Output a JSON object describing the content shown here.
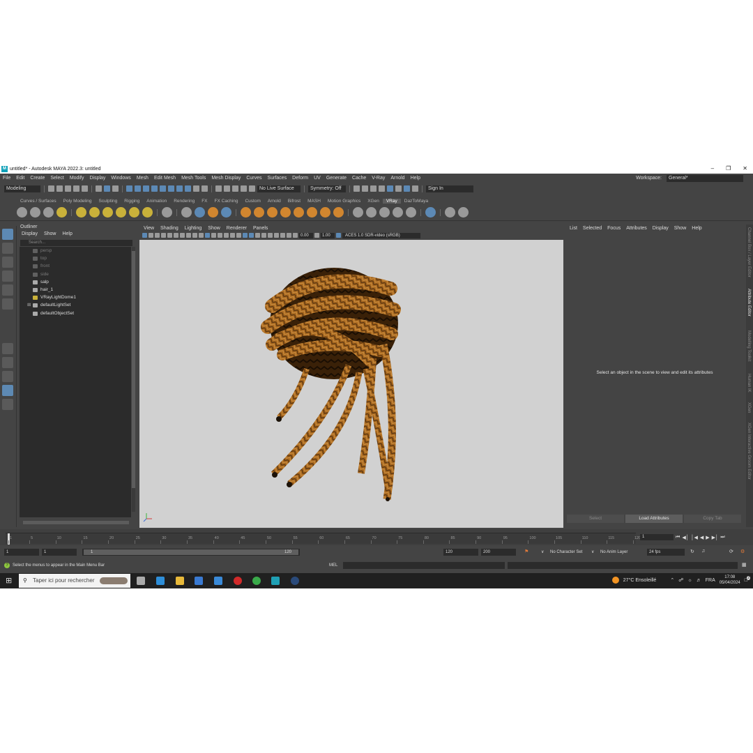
{
  "window": {
    "title": "untitled* - Autodesk MAYA 2022.3: untitled",
    "logo_text": "M"
  },
  "menubar": {
    "items": [
      "File",
      "Edit",
      "Create",
      "Select",
      "Modify",
      "Display",
      "Windows",
      "Mesh",
      "Edit Mesh",
      "Mesh Tools",
      "Mesh Display",
      "Curves",
      "Surfaces",
      "Deform",
      "UV",
      "Generate",
      "Cache",
      "V-Ray",
      "Arnold",
      "Help"
    ],
    "workspace_label": "Workspace:",
    "workspace_value": "General*"
  },
  "statusline": {
    "mode": "Modeling",
    "live_surface": "No Live Surface",
    "symmetry": "Symmetry: Off",
    "sign_in": "Sign In"
  },
  "shelf_tabs": [
    "Curves / Surfaces",
    "Poly Modeling",
    "Sculpting",
    "Rigging",
    "Animation",
    "Rendering",
    "FX",
    "FX Caching",
    "Custom",
    "Arnold",
    "Bifrost",
    "MASH",
    "Motion Graphics",
    "XGen",
    "VRay",
    "DazToMaya"
  ],
  "shelf_active": "VRay",
  "outliner": {
    "title": "Outliner",
    "menu": [
      "Display",
      "Show",
      "Help"
    ],
    "search_placeholder": "Search...",
    "items": [
      {
        "label": "persp",
        "dim": true
      },
      {
        "label": "top",
        "dim": true
      },
      {
        "label": "front",
        "dim": true
      },
      {
        "label": "side",
        "dim": true
      },
      {
        "label": "salp",
        "dim": false
      },
      {
        "label": "hair_1",
        "dim": false
      },
      {
        "label": "VRayLightDome1",
        "dim": false
      },
      {
        "label": "defaultLightSet",
        "dim": false
      },
      {
        "label": "defaultObjectSet",
        "dim": false
      }
    ]
  },
  "viewport": {
    "menu": [
      "View",
      "Shading",
      "Lighting",
      "Show",
      "Renderer",
      "Panels"
    ],
    "exposure": "0.00",
    "gamma": "1.00",
    "color_space": "ACES 1.0 SDR-video (sRGB)"
  },
  "attribute_editor": {
    "menu": [
      "List",
      "Selected",
      "Focus",
      "Attributes",
      "Display",
      "Show",
      "Help"
    ],
    "message": "Select an object in the scene to view and edit its attributes",
    "buttons": [
      "Select",
      "Load Attributes",
      "Copy Tab"
    ]
  },
  "side_tabs": [
    "Channel Box / Layer Editor",
    "Attribute Editor",
    "Modelling Toolkit",
    "Human IK",
    "XGen",
    "XGen Interactive Groom Editor"
  ],
  "timeline": {
    "ticks": [
      "1",
      "5",
      "10",
      "15",
      "20",
      "25",
      "30",
      "35",
      "40",
      "45",
      "50",
      "55",
      "60",
      "65",
      "70",
      "75",
      "80",
      "85",
      "90",
      "95",
      "100",
      "105",
      "110",
      "115",
      "120"
    ],
    "current_frame": "1"
  },
  "range": {
    "start": "1",
    "playback_start": "1",
    "slider_start": "1",
    "slider_end": "120",
    "playback_end": "120",
    "end": "200",
    "character_set": "No Character Set",
    "anim_layer": "No Anim Layer",
    "fps": "24 fps"
  },
  "command_line": {
    "help_text": "Select the menus to appear in the Main Menu Bar",
    "language": "MEL"
  },
  "taskbar": {
    "search_placeholder": "Taper ici pour rechercher",
    "weather": "27°C  Ensoleillé",
    "lang": "FRA",
    "time": "17:08",
    "date": "05/04/2024",
    "notifications": "2"
  }
}
